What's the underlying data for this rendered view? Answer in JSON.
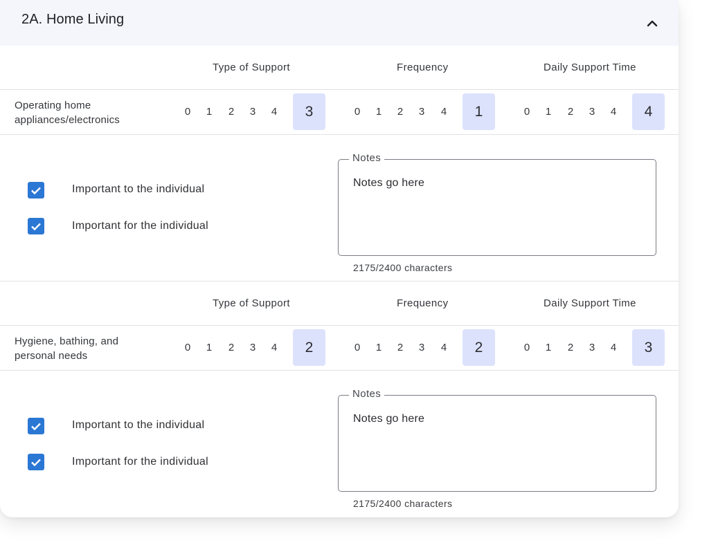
{
  "section": {
    "title": "2A. Home Living",
    "collapse_icon": "chevron-up-icon"
  },
  "columns": [
    "Type of Support",
    "Frequency",
    "Daily Support Time"
  ],
  "scale_options": [
    "0",
    "1",
    "2",
    "3",
    "4"
  ],
  "colors": {
    "header_bg": "#f5f6fc",
    "selected_bg": "#dde2fc",
    "checkbox": "#2b77d4",
    "divider": "#e2e2e6"
  },
  "items": [
    {
      "label_line1": "Operating home",
      "label_line2": "appliances/electronics",
      "type_of_support": "3",
      "frequency": "1",
      "daily_support_time": "4",
      "checkboxes": [
        {
          "label": "Important to the individual",
          "checked": true
        },
        {
          "label": "Important for the individual",
          "checked": true
        }
      ],
      "notes": {
        "legend": "Notes",
        "value": "Notes go here",
        "char_count": "2175/2400 characters"
      }
    },
    {
      "label_line1": "Hygiene, bathing, and",
      "label_line2": "personal needs",
      "type_of_support": "2",
      "frequency": "2",
      "daily_support_time": "3",
      "checkboxes": [
        {
          "label": "Important to the individual",
          "checked": true
        },
        {
          "label": "Important for the individual",
          "checked": true
        }
      ],
      "notes": {
        "legend": "Notes",
        "value": "Notes go here",
        "char_count": "2175/2400 characters"
      }
    }
  ]
}
